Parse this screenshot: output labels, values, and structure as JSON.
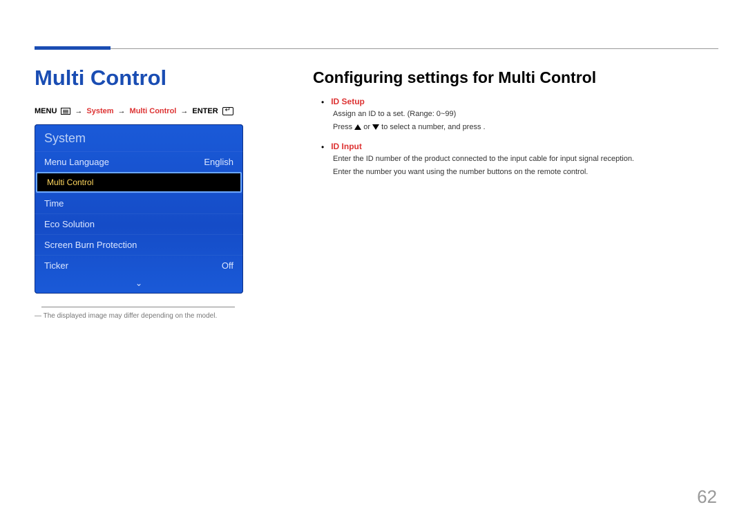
{
  "page": {
    "title": "Multi Control",
    "number": "62"
  },
  "breadcrumb": {
    "menu": "MENU",
    "arrow": "→",
    "system": "System",
    "multiControl": "Multi Control",
    "enter": "ENTER"
  },
  "osd": {
    "title": "System",
    "items": [
      {
        "label": "Menu Language",
        "value": "English",
        "selected": false
      },
      {
        "label": "Multi Control",
        "value": "",
        "selected": true
      },
      {
        "label": "Time",
        "value": "",
        "selected": false
      },
      {
        "label": "Eco Solution",
        "value": "",
        "selected": false
      },
      {
        "label": "Screen Burn Protection",
        "value": "",
        "selected": false
      },
      {
        "label": "Ticker",
        "value": "Off",
        "selected": false
      }
    ],
    "more": "⌄"
  },
  "footnote": "― The displayed image may differ depending on the model.",
  "section": {
    "heading": "Configuring settings for Multi Control",
    "items": [
      {
        "label": "ID Setup",
        "desc1": "Assign an ID to a set. (Range: 0~99)",
        "desc2_a": "Press ",
        "desc2_b": " or ",
        "desc2_c": " to select a number, and press ",
        "desc2_d": "."
      },
      {
        "label": "ID Input",
        "desc1": "Enter the ID number of the product connected to the input cable for input signal reception.",
        "desc2": "Enter the number you want using the number buttons on the remote control."
      }
    ]
  }
}
